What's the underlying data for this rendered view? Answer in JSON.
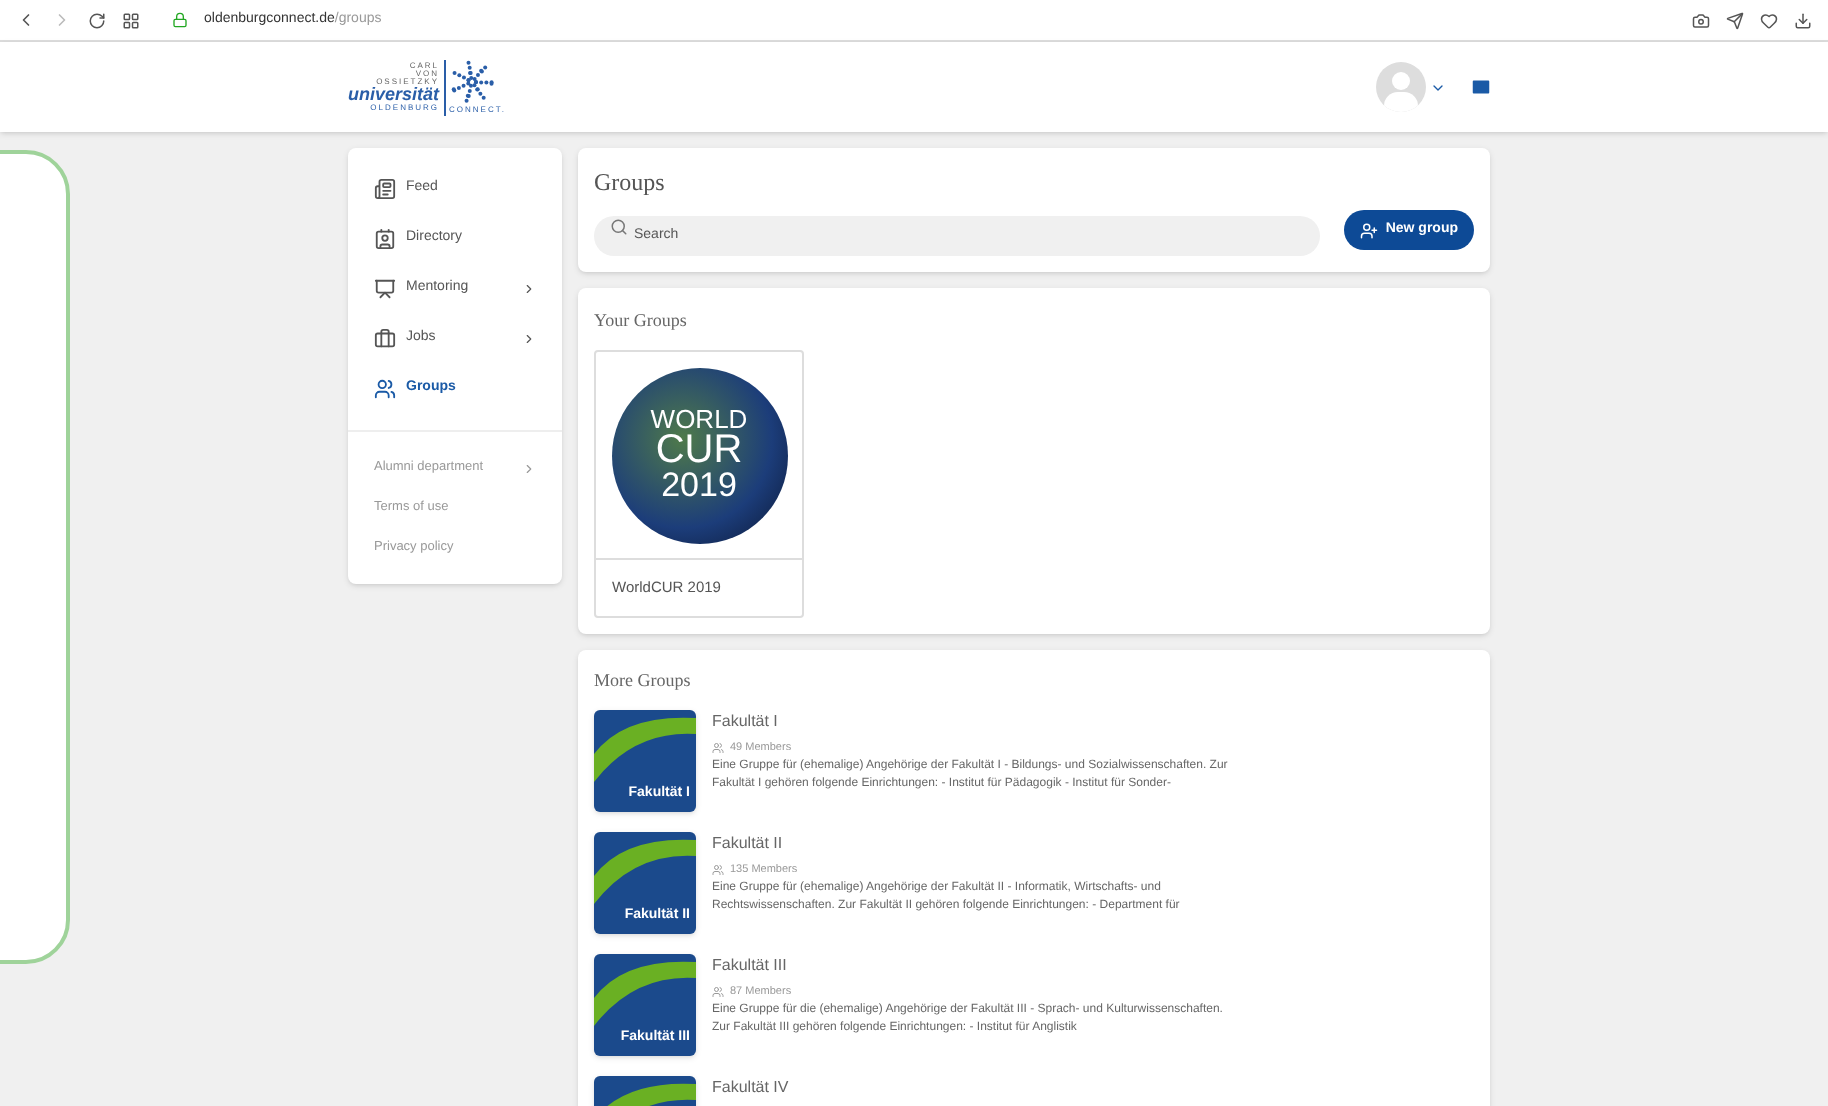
{
  "browser": {
    "url_host": "oldenburgconnect.de",
    "url_path": "/groups"
  },
  "header": {
    "logo_lines": [
      "CARL",
      "VON",
      "OSSIETZKY",
      "universität",
      "OLDENBURG",
      "CONNECT."
    ]
  },
  "sidebar": {
    "items": [
      {
        "kind": "feed",
        "label": "Feed",
        "selected": false,
        "submenu": false
      },
      {
        "kind": "directory",
        "label": "Directory",
        "selected": false,
        "submenu": false
      },
      {
        "kind": "mentoring",
        "label": "Mentoring",
        "selected": false,
        "submenu": true
      },
      {
        "kind": "jobs",
        "label": "Jobs",
        "selected": false,
        "submenu": true
      },
      {
        "kind": "groups",
        "label": "Groups",
        "selected": true,
        "submenu": false
      }
    ],
    "links": [
      {
        "label": "Alumni department",
        "submenu": true
      },
      {
        "label": "Terms of use",
        "submenu": false
      },
      {
        "label": "Privacy policy",
        "submenu": false
      }
    ]
  },
  "groups_header": {
    "title": "Groups",
    "search": {
      "placeholder": "Search"
    },
    "button": "New group"
  },
  "your_groups": {
    "title": "Your Groups",
    "items": [
      {
        "name": "WorldCUR 2019",
        "image_text": [
          "WORLD",
          "CUR",
          "2019"
        ]
      }
    ]
  },
  "more_groups": {
    "title": "More Groups",
    "items": [
      {
        "name": "Fakultät I",
        "image_text": "Fakultät I",
        "members": "49 Members",
        "description": "Eine Gruppe für (ehemalige) Angehörige der Fakultät I - Bildungs- und Sozialwissenschaften. Zur Fakultät I gehören folgende Einrichtungen: - Institut für Pädagogik - Institut für Sonder-"
      },
      {
        "name": "Fakultät II",
        "image_text": "Fakultät II",
        "members": "135 Members",
        "description": "Eine Gruppe für (ehemalige) Angehörige der Fakultät II - Informatik, Wirtschafts- und Rechtswissenschaften. Zur Fakultät II gehören folgende Einrichtungen: - Department für"
      },
      {
        "name": "Fakultät III",
        "image_text": "Fakultät III",
        "members": "87 Members",
        "description": "Eine Gruppe für die (ehemalige) Angehörige der Fakultät III - Sprach- und Kulturwissenschaften. Zur Fakultät III gehören folgende Einrichtungen: - Institut für Anglistik"
      },
      {
        "name": "Fakultät IV"
      }
    ]
  }
}
